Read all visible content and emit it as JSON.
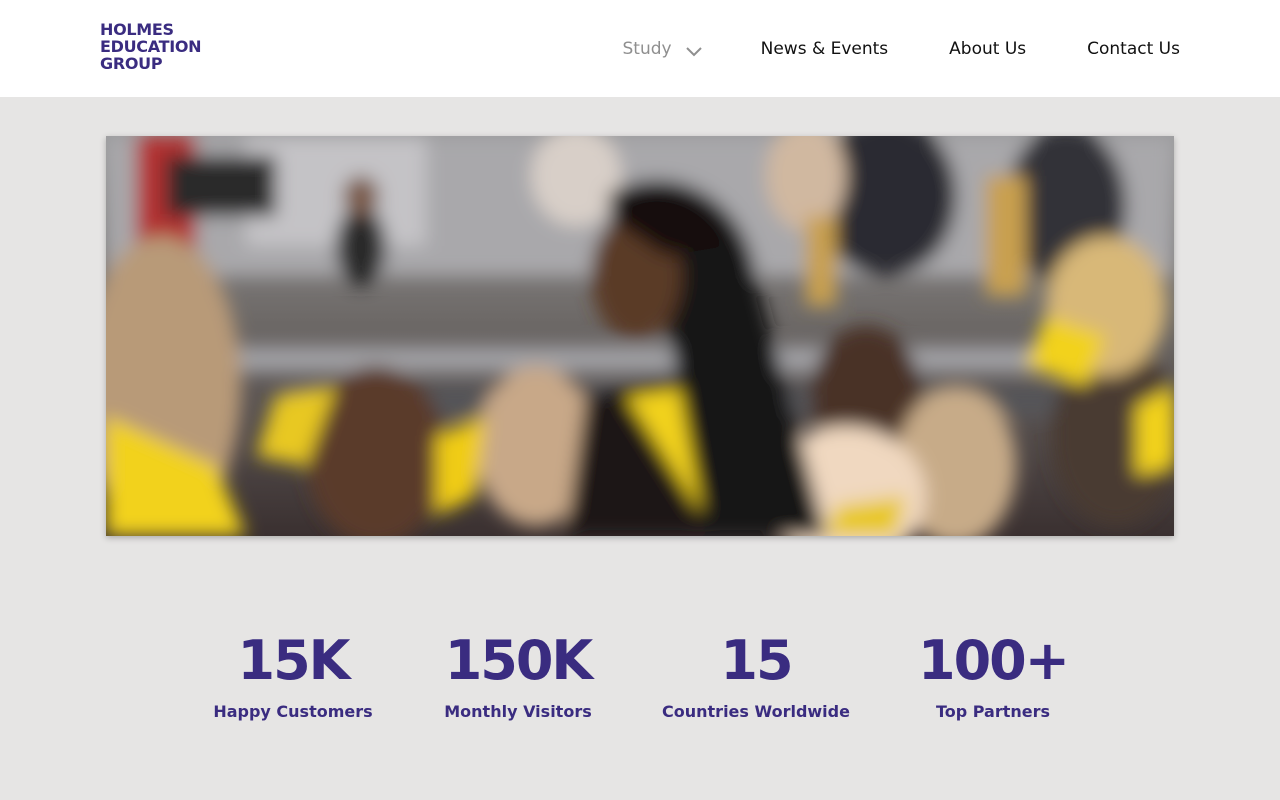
{
  "brand": {
    "logo_line1": "HOLMES",
    "logo_line2": "EDUCATION",
    "logo_line3": "GROUP",
    "color": "#3a2c80"
  },
  "nav": {
    "study": "Study",
    "news_events": "News & Events",
    "about": "About Us",
    "contact": "Contact Us"
  },
  "hero": {
    "icon": "graduation-photo"
  },
  "stats": [
    {
      "value": "15K",
      "label": "Happy Customers"
    },
    {
      "value": "150K",
      "label": "Monthly Visitors"
    },
    {
      "value": "15",
      "label": "Countries Worldwide"
    },
    {
      "value": "100+",
      "label": "Top Partners"
    }
  ]
}
